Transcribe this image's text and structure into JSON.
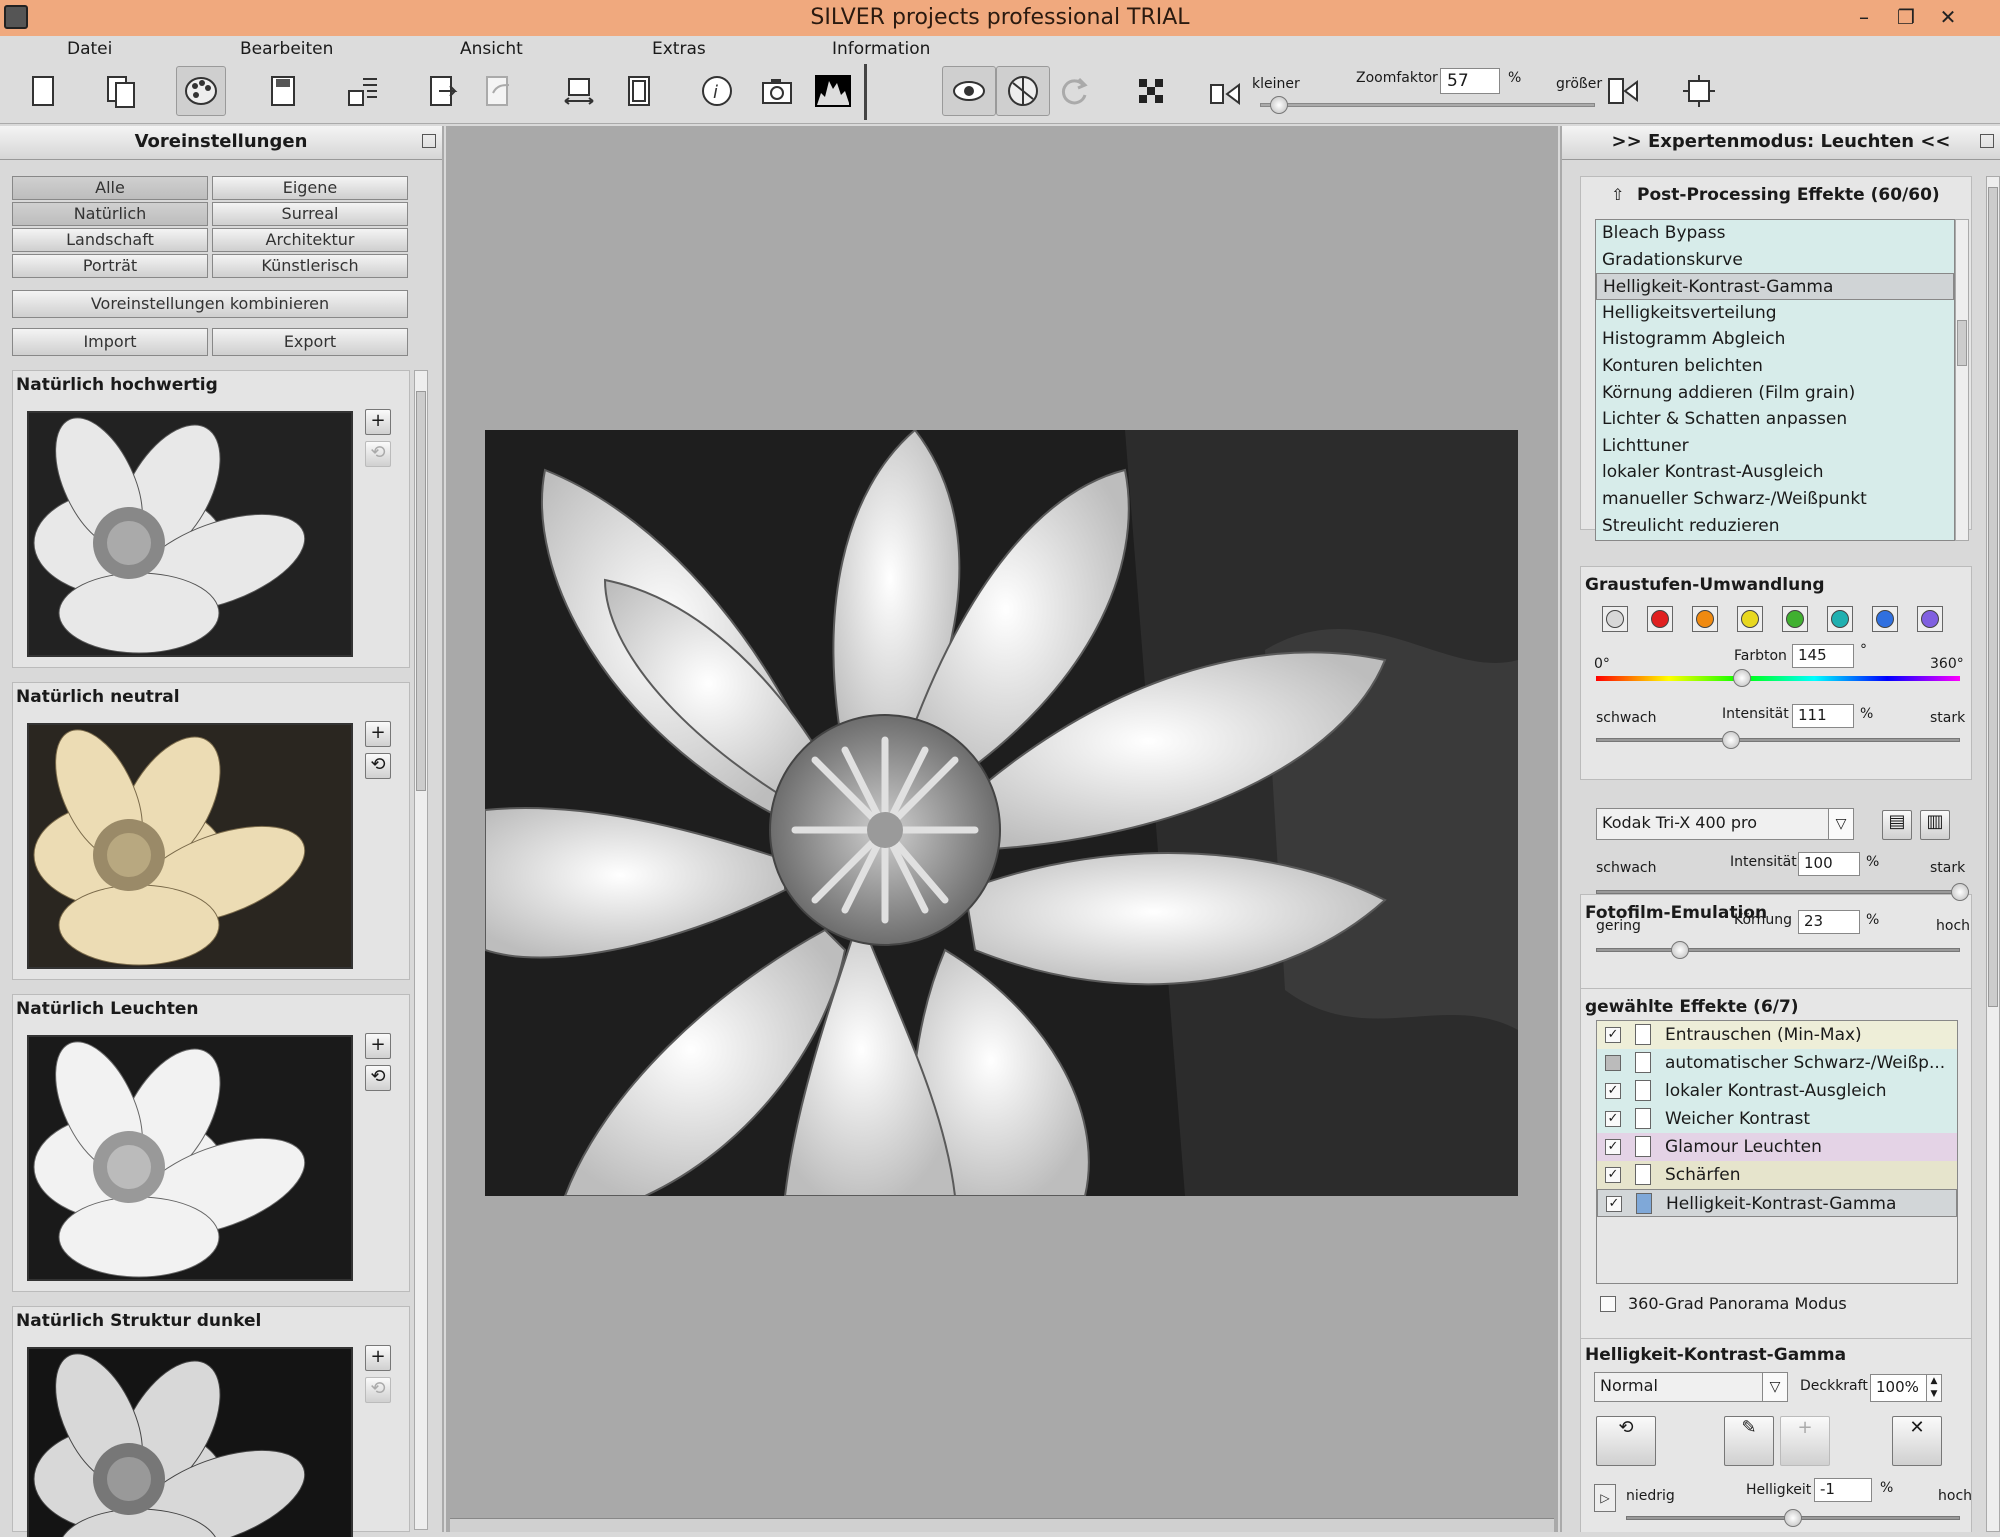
{
  "window": {
    "title": "SILVER projects professional  TRIAL",
    "controls": [
      "–",
      "❐",
      "✕"
    ]
  },
  "menu": [
    "Datei",
    "Bearbeiten",
    "Ansicht",
    "Extras",
    "Information"
  ],
  "toolbar": {
    "zoom_small_label": "kleiner",
    "zoom_label": "Zoomfaktor",
    "zoom_value": "57",
    "zoom_unit": "%",
    "zoom_big_label": "größer",
    "zoom_level_fraction": 0.03
  },
  "left": {
    "header": "Voreinstellungen",
    "filters": [
      "Alle",
      "Eigene",
      "Natürlich",
      "Surreal",
      "Landschaft",
      "Architektur",
      "Porträt",
      "Künstlerisch"
    ],
    "combine": "Voreinstellungen kombinieren",
    "import": "Import",
    "export": "Export",
    "presets": [
      "Natürlich hochwertig",
      "Natürlich neutral",
      "Natürlich Leuchten",
      "Natürlich Struktur dunkel"
    ]
  },
  "right": {
    "header": ">> Expertenmodus: Leuchten <<",
    "pp": {
      "title": "Post-Processing Effekte (60/60)",
      "items": [
        "Bleach Bypass",
        "Gradationskurve",
        "Helligkeit-Kontrast-Gamma",
        "Helligkeitsverteilung",
        "Histogramm Abgleich",
        "Konturen belichten",
        "Körnung addieren (Film grain)",
        "Lichter & Schatten anpassen",
        "Lichttuner",
        "lokaler Kontrast-Ausgleich",
        "manueller Schwarz-/Weißpunkt",
        "Streulicht reduzieren"
      ],
      "selected_index": 2
    },
    "gray": {
      "title": "Graustufen-Umwandlung",
      "swatch_colors": [
        "#d8d8d8",
        "#e02020",
        "#f08a10",
        "#e8d820",
        "#40b030",
        "#20b0b0",
        "#3070e0",
        "#8060e0"
      ],
      "hue_min": "0°",
      "hue_label": "Farbton",
      "hue_value": "145",
      "hue_unit": "°",
      "hue_max": "360°",
      "weak": "schwach",
      "int_label": "Intensität",
      "int_value": "111",
      "int_unit": "%",
      "strong": "stark",
      "hue_fraction": 0.4,
      "int_fraction": 0.37
    },
    "film": {
      "title": "Fotofilm-Emulation",
      "film_select": "Kodak Tri-X 400 pro",
      "weak": "schwach",
      "int_label": "Intensität",
      "int_value": "100",
      "int_unit": "%",
      "strong": "stark",
      "low": "gering",
      "grain_label": "Körnung",
      "grain_value": "23",
      "grain_unit": "%",
      "high": "hoch",
      "int_fraction": 1.0,
      "grain_fraction": 0.23
    },
    "chosen": {
      "title": "gewählte Effekte (6/7)",
      "items": [
        {
          "label": "Entrauschen (Min-Max)",
          "checked": true,
          "color": "#eeeed8"
        },
        {
          "label": "automatischer Schwarz-/Weißp...",
          "checked": false,
          "color": "#d7ecea"
        },
        {
          "label": "lokaler Kontrast-Ausgleich",
          "checked": true,
          "color": "#d7ecea"
        },
        {
          "label": "Weicher Kontrast",
          "checked": true,
          "color": "#d7ecea"
        },
        {
          "label": "Glamour Leuchten",
          "checked": true,
          "color": "#e4d3e6"
        },
        {
          "label": "Schärfen",
          "checked": true,
          "color": "#e6e4cc"
        },
        {
          "label": "Helligkeit-Kontrast-Gamma",
          "checked": true,
          "color": "#d2d6d8"
        }
      ],
      "panorama": "360-Grad Panorama Modus"
    },
    "hkg": {
      "title": "Helligkeit-Kontrast-Gamma",
      "blend": "Normal",
      "opacity_label": "Deckkraft",
      "opacity_value": "100%",
      "low": "niedrig",
      "bright_label": "Helligkeit",
      "bright_value": "-1",
      "bright_unit": "%",
      "high": "hoch",
      "bright_fraction": 0.5
    }
  }
}
